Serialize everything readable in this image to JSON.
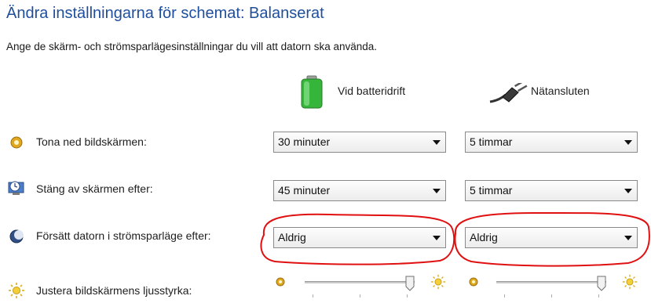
{
  "header": {
    "title": "Ändra inställningarna för schemat: Balanserat",
    "subtitle": "Ange de skärm- och strömsparlägesinställningar du vill att datorn ska använda."
  },
  "columns": {
    "battery_label": "Vid batteridrift",
    "plugged_label": "Nätansluten"
  },
  "rows": {
    "dim": {
      "label": "Tona ned bildskärmen:",
      "battery": "30 minuter",
      "plugged": "5 timmar"
    },
    "off": {
      "label": "Stäng av skärmen efter:",
      "battery": "45 minuter",
      "plugged": "5 timmar"
    },
    "sleep": {
      "label": "Försätt datorn i strömsparläge efter:",
      "battery": "Aldrig",
      "plugged": "Aldrig"
    },
    "brightness": {
      "label": "Justera bildskärmens ljusstyrka:",
      "battery_level": 1.0,
      "plugged_level": 1.0
    }
  },
  "colors": {
    "title": "#1f4e9c",
    "annotation": "#e01010"
  }
}
